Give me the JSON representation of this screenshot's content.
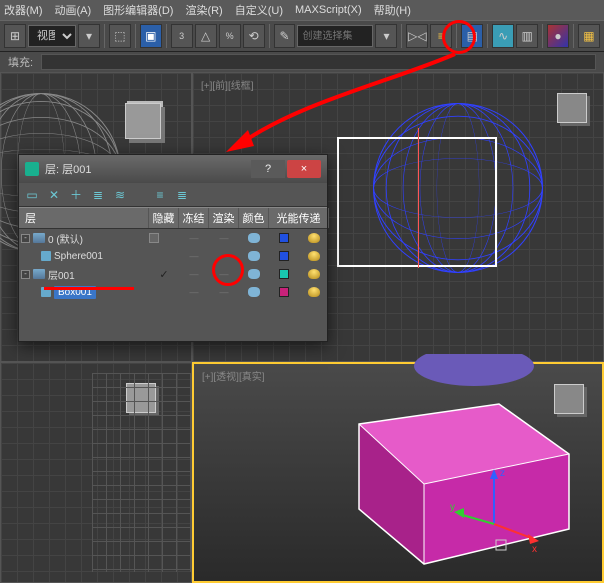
{
  "menubar": {
    "items": [
      "改器(M)",
      "动画(A)",
      "图形编辑器(D)",
      "渲染(R)",
      "自定义(U)",
      "MAXScript(X)",
      "帮助(H)"
    ]
  },
  "toolbar": {
    "view_label": "视图",
    "selset_placeholder": "创建选择集"
  },
  "fillbar": {
    "label": "填充:"
  },
  "viewports": {
    "top_left": "[+][...]",
    "top_right": "[+][前][线框]",
    "bottom_left": "[+][...]",
    "bottom_right": "[+][透视][真实]"
  },
  "dialog": {
    "title": "层: 层001",
    "help": "?",
    "close": "×",
    "headers": {
      "layer": "层",
      "hide": "隐藏",
      "freeze": "冻结",
      "render": "渲染",
      "color": "颜色",
      "radiosity": "光能传递"
    },
    "rows": [
      {
        "name": "0 (默认)",
        "color": "#2050e0"
      },
      {
        "name": "Sphere001",
        "color": "#2050e0",
        "child": true
      },
      {
        "name": "层001",
        "color": "#18c8b0",
        "checked": true
      },
      {
        "name": "Box001",
        "color": "#c8227a",
        "child": true,
        "selected": true
      }
    ]
  },
  "colors": {
    "accent_orange": "#ffcc33",
    "accent_red": "#ff0000",
    "box_fill": "#c62aa8",
    "box_top": "#e65bc9",
    "sphere_gray": "#888888",
    "sphere_blue": "#3040ff"
  }
}
